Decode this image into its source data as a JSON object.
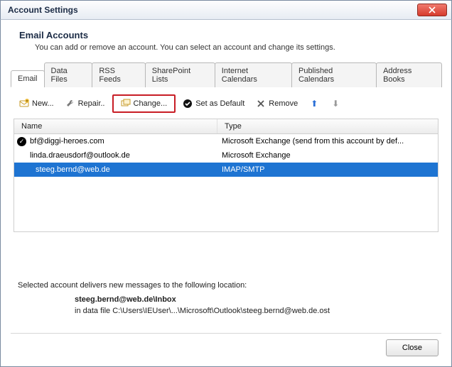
{
  "window": {
    "title": "Account Settings"
  },
  "header": {
    "title": "Email Accounts",
    "desc": "You can add or remove an account. You can select an account and change its settings."
  },
  "tabs": {
    "t0": "Email",
    "t1": "Data Files",
    "t2": "RSS Feeds",
    "t3": "SharePoint Lists",
    "t4": "Internet Calendars",
    "t5": "Published Calendars",
    "t6": "Address Books"
  },
  "toolbar": {
    "new": "New...",
    "repair": "Repair..",
    "change": "Change...",
    "setdefault": "Set as Default",
    "remove": "Remove"
  },
  "columns": {
    "name": "Name",
    "type": "Type"
  },
  "accounts": {
    "a0": {
      "name": "bf@diggi-heroes.com",
      "type": "Microsoft Exchange (send from this account by def..."
    },
    "a1": {
      "name": "linda.draeusdorf@outlook.de",
      "type": "Microsoft Exchange"
    },
    "a2": {
      "name": "steeg.bernd@web.de",
      "type": "IMAP/SMTP"
    }
  },
  "delivery": {
    "intro": "Selected account delivers new messages to the following location:",
    "folder": "steeg.bernd@web.de\\Inbox",
    "path": "in data file C:\\Users\\IEUser\\...\\Microsoft\\Outlook\\steeg.bernd@web.de.ost"
  },
  "footer": {
    "close": "Close"
  }
}
